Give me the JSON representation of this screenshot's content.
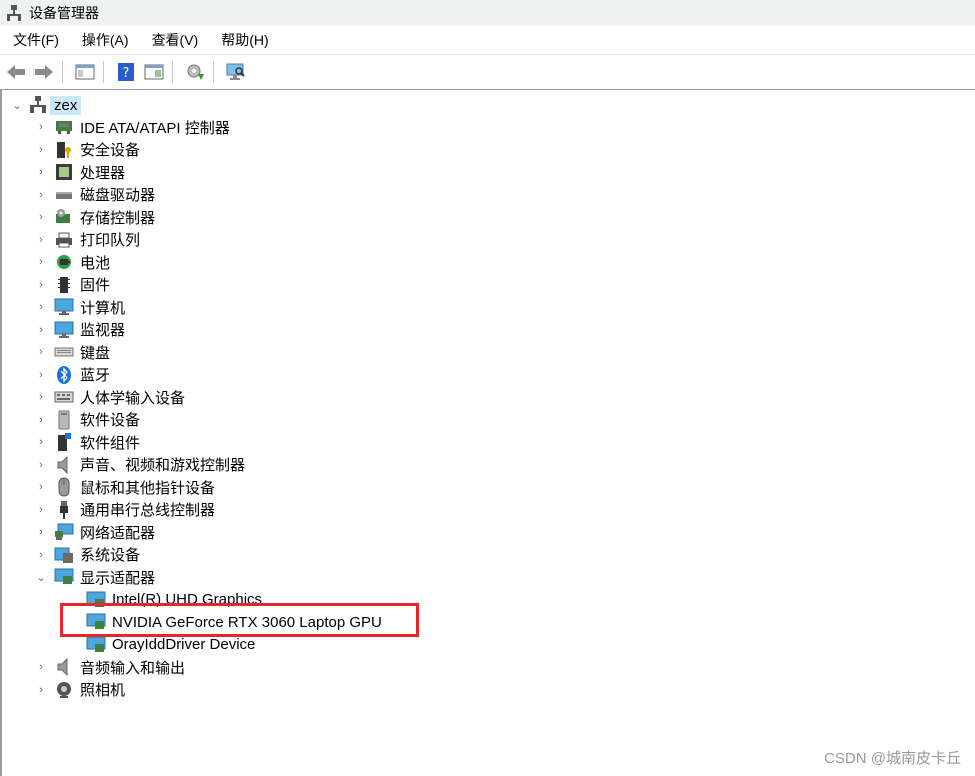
{
  "window": {
    "title": "设备管理器",
    "icon": "device-manager-icon"
  },
  "menu": {
    "items": [
      "文件(F)",
      "操作(A)",
      "查看(V)",
      "帮助(H)"
    ]
  },
  "toolbar": {
    "buttons": [
      "back-arrow-icon",
      "forward-arrow-icon",
      "show-hide-console-tree-icon",
      "help-icon",
      "properties-pane-icon",
      "update-driver-icon",
      "scan-hardware-icon"
    ]
  },
  "tree": {
    "root": {
      "label": "zex",
      "icon": "computer-icon",
      "expanded": true
    },
    "categories": [
      {
        "label": "IDE ATA/ATAPI 控制器",
        "icon": "ide-controller-icon",
        "expanded": false
      },
      {
        "label": "安全设备",
        "icon": "security-device-icon",
        "expanded": false
      },
      {
        "label": "处理器",
        "icon": "processor-icon",
        "expanded": false
      },
      {
        "label": "磁盘驱动器",
        "icon": "disk-drive-icon",
        "expanded": false
      },
      {
        "label": "存储控制器",
        "icon": "storage-controller-icon",
        "expanded": false
      },
      {
        "label": "打印队列",
        "icon": "printer-icon",
        "expanded": false
      },
      {
        "label": "电池",
        "icon": "battery-icon",
        "expanded": false
      },
      {
        "label": "固件",
        "icon": "firmware-icon",
        "expanded": false
      },
      {
        "label": "计算机",
        "icon": "computer-monitor-icon",
        "expanded": false
      },
      {
        "label": "监视器",
        "icon": "monitor-icon",
        "expanded": false
      },
      {
        "label": "键盘",
        "icon": "keyboard-icon",
        "expanded": false
      },
      {
        "label": "蓝牙",
        "icon": "bluetooth-icon",
        "expanded": false
      },
      {
        "label": "人体学输入设备",
        "icon": "hid-icon",
        "expanded": false
      },
      {
        "label": "软件设备",
        "icon": "software-device-icon",
        "expanded": false
      },
      {
        "label": "软件组件",
        "icon": "software-component-icon",
        "expanded": false
      },
      {
        "label": "声音、视频和游戏控制器",
        "icon": "speaker-icon",
        "expanded": false
      },
      {
        "label": "鼠标和其他指针设备",
        "icon": "mouse-icon",
        "expanded": false
      },
      {
        "label": "通用串行总线控制器",
        "icon": "usb-icon",
        "expanded": false
      },
      {
        "label": "网络适配器",
        "icon": "network-adapter-icon",
        "expanded": false
      },
      {
        "label": "系统设备",
        "icon": "system-device-icon",
        "expanded": false
      },
      {
        "label": "显示适配器",
        "icon": "display-adapter-icon",
        "expanded": true,
        "children": [
          {
            "label": "Intel(R) UHD Graphics",
            "icon": "display-adapter-icon"
          },
          {
            "label": "NVIDIA GeForce RTX 3060 Laptop GPU",
            "icon": "display-adapter-icon"
          },
          {
            "label": "OrayIddDriver Device",
            "icon": "display-adapter-icon"
          }
        ]
      },
      {
        "label": "音频输入和输出",
        "icon": "audio-io-icon",
        "expanded": false
      },
      {
        "label": "照相机",
        "icon": "camera-icon",
        "expanded": false
      }
    ]
  },
  "watermark": "CSDN @城南皮卡丘",
  "colors": {
    "highlight_border": "#e8262a",
    "root_selection": "#cce8ff",
    "titlebar": "#eef3f1"
  }
}
